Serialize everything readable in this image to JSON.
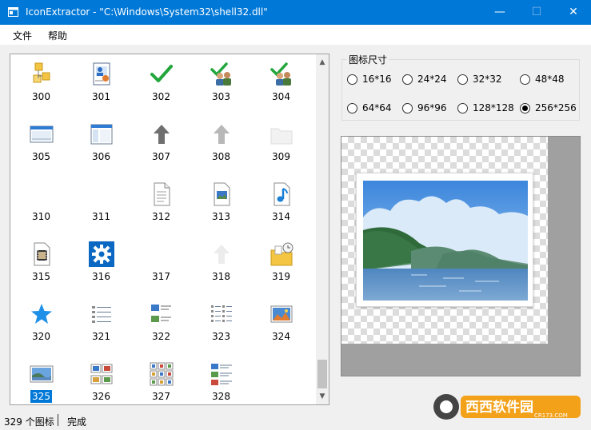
{
  "window": {
    "title": "IconExtractor - \"C:\\Windows\\System32\\shell32.dll\"",
    "controls": {
      "minimize": "—",
      "maximize": "☐",
      "close": "✕"
    }
  },
  "menu": [
    "文件",
    "帮助"
  ],
  "icon_list": {
    "items": [
      {
        "number": "300",
        "icon": "folder-tree-icon"
      },
      {
        "number": "301",
        "icon": "user-document-icon"
      },
      {
        "number": "302",
        "icon": "green-checkmark-icon"
      },
      {
        "number": "303",
        "icon": "users-checkmark-icon"
      },
      {
        "number": "304",
        "icon": "users-checkmark-icon"
      },
      {
        "number": "305",
        "icon": "window-pane-icon"
      },
      {
        "number": "306",
        "icon": "window-columns-icon"
      },
      {
        "number": "307",
        "icon": "up-arrow-icon"
      },
      {
        "number": "308",
        "icon": "up-arrow-faded-icon"
      },
      {
        "number": "309",
        "icon": "folder-faded-icon"
      },
      {
        "number": "310",
        "icon": "blank-icon"
      },
      {
        "number": "311",
        "icon": "blank-icon"
      },
      {
        "number": "312",
        "icon": "text-document-icon"
      },
      {
        "number": "313",
        "icon": "image-document-icon"
      },
      {
        "number": "314",
        "icon": "music-document-icon"
      },
      {
        "number": "315",
        "icon": "video-document-icon"
      },
      {
        "number": "316",
        "icon": "gear-icon"
      },
      {
        "number": "317",
        "icon": "blank-icon"
      },
      {
        "number": "318",
        "icon": "up-arrow-very-faded-icon"
      },
      {
        "number": "319",
        "icon": "scheduled-folder-icon"
      },
      {
        "number": "320",
        "icon": "star-icon"
      },
      {
        "number": "321",
        "icon": "details-view-icon"
      },
      {
        "number": "322",
        "icon": "tiles-view-icon"
      },
      {
        "number": "323",
        "icon": "list-view-icon"
      },
      {
        "number": "324",
        "icon": "photo-landscape-icon"
      },
      {
        "number": "325",
        "icon": "photo-thumbnail-icon"
      },
      {
        "number": "326",
        "icon": "small-thumbnails-icon"
      },
      {
        "number": "327",
        "icon": "thumbnail-grid-icon"
      },
      {
        "number": "328",
        "icon": "content-view-icon"
      }
    ],
    "selected": "325"
  },
  "size_group": {
    "legend": "图标尺寸",
    "options": [
      "16*16",
      "24*24",
      "32*32",
      "48*48",
      "64*64",
      "96*96",
      "128*128",
      "256*256"
    ],
    "selected": "256*256"
  },
  "preview": {
    "icon": "landscape-photo-preview-icon"
  },
  "status": {
    "count": "329 个图标",
    "state": "完成"
  },
  "watermark": {
    "text": "西西软件园",
    "url": "CR173.COM"
  },
  "colors": {
    "titlebar": "#0078d7",
    "selection": "#0078d7",
    "check_green": "#22a63c",
    "gear_blue": "#0b68c2"
  }
}
